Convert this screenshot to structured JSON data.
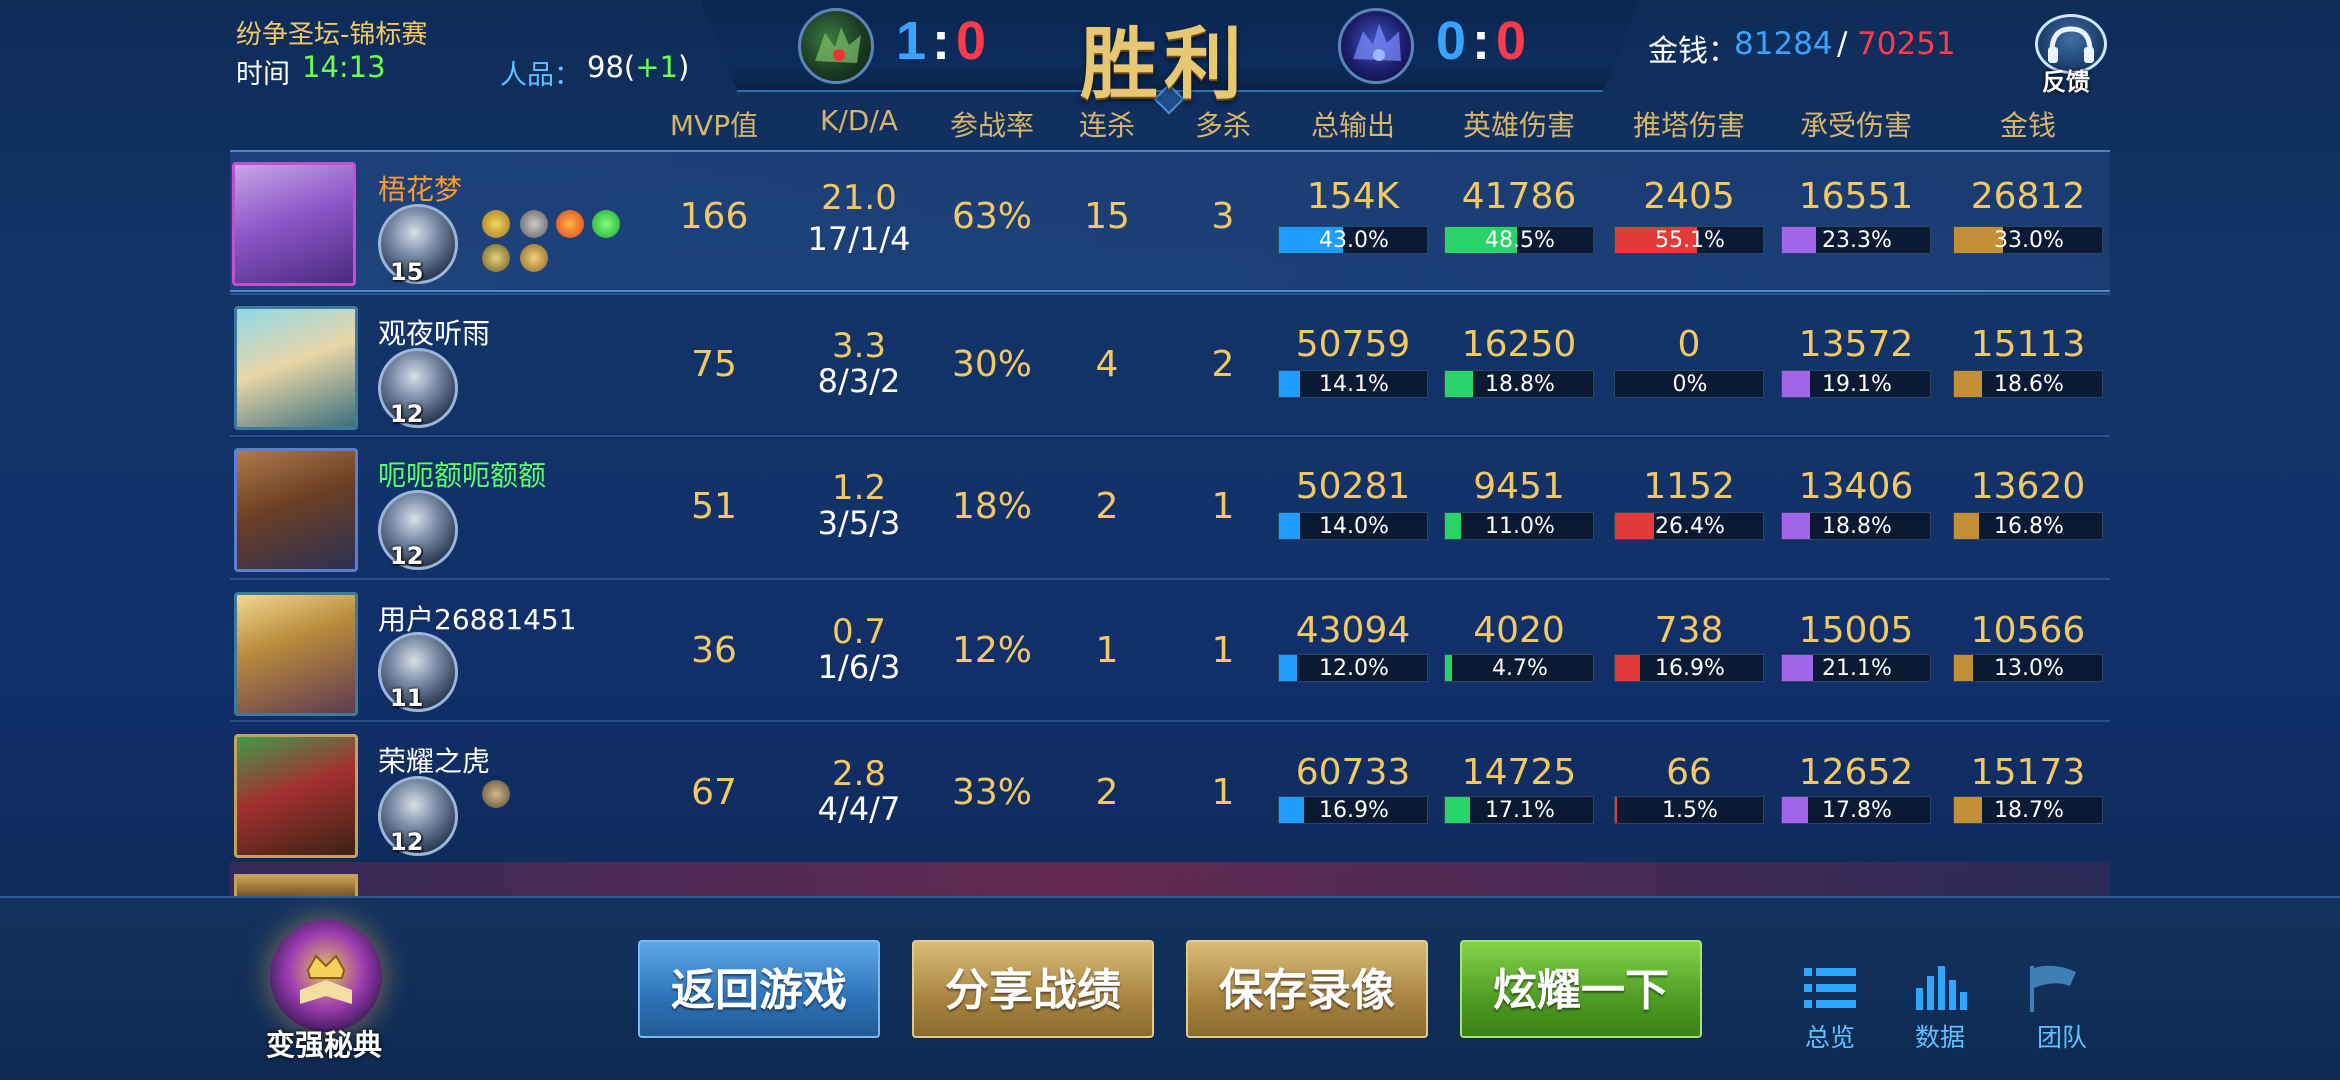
{
  "header": {
    "match_title": "纷争圣坛-锦标赛",
    "time_label": "时间",
    "time_value": "14:13",
    "rp_label": "人品：",
    "rp_value": "98(",
    "rp_plus": "+1",
    "rp_close": ")",
    "score_left": {
      "blue": "1",
      "colon": ":",
      "red": "0"
    },
    "result": "胜利",
    "score_right": {
      "blue": "0",
      "colon": ":",
      "red": "0"
    },
    "gold_label": "金钱：",
    "gold_blue": "81284",
    "gold_sep": "/",
    "gold_red": "70251",
    "feedback_label": "反馈",
    "feedback_icon": "headset-icon",
    "left_team_icon": "dragon-emblem-icon",
    "right_team_icon": "dark-dragon-emblem-icon"
  },
  "columns": {
    "mvp": "MVP值",
    "kda": "K/D/A",
    "participation": "参战率",
    "streak": "连杀",
    "multikill": "多杀",
    "total_output": "总输出",
    "hero_damage": "英雄伤害",
    "tower_damage": "推塔伤害",
    "damage_taken": "承受伤害",
    "gold": "金钱"
  },
  "players": [
    {
      "name": "梧花梦",
      "level": "15",
      "mvp": "166",
      "kda_ratio": "21.0",
      "kda": "17/1/4",
      "participation": "63%",
      "streak": "15",
      "multikill": "3",
      "output": "154K",
      "output_pct": "43.0%",
      "output_fill": 0.43,
      "hero": "41786",
      "hero_pct": "48.5%",
      "hero_fill": 0.485,
      "tower": "2405",
      "tower_pct": "55.1%",
      "tower_fill": 0.551,
      "taken": "16551",
      "taken_pct": "23.3%",
      "taken_fill": 0.233,
      "gold": "26812",
      "gold_pct": "33.0%",
      "gold_fill": 0.33
    },
    {
      "name": "观夜听雨",
      "level": "12",
      "mvp": "75",
      "kda_ratio": "3.3",
      "kda": "8/3/2",
      "participation": "30%",
      "streak": "4",
      "multikill": "2",
      "output": "50759",
      "output_pct": "14.1%",
      "output_fill": 0.141,
      "hero": "16250",
      "hero_pct": "18.8%",
      "hero_fill": 0.188,
      "tower": "0",
      "tower_pct": "0%",
      "tower_fill": 0,
      "taken": "13572",
      "taken_pct": "19.1%",
      "taken_fill": 0.191,
      "gold": "15113",
      "gold_pct": "18.6%",
      "gold_fill": 0.186
    },
    {
      "name": "呃呃额呃额额",
      "level": "12",
      "mvp": "51",
      "kda_ratio": "1.2",
      "kda": "3/5/3",
      "participation": "18%",
      "streak": "2",
      "multikill": "1",
      "output": "50281",
      "output_pct": "14.0%",
      "output_fill": 0.14,
      "hero": "9451",
      "hero_pct": "11.0%",
      "hero_fill": 0.11,
      "tower": "1152",
      "tower_pct": "26.4%",
      "tower_fill": 0.264,
      "taken": "13406",
      "taken_pct": "18.8%",
      "taken_fill": 0.188,
      "gold": "13620",
      "gold_pct": "16.8%",
      "gold_fill": 0.168
    },
    {
      "name": "用户26881451",
      "level": "11",
      "mvp": "36",
      "kda_ratio": "0.7",
      "kda": "1/6/3",
      "participation": "12%",
      "streak": "1",
      "multikill": "1",
      "output": "43094",
      "output_pct": "12.0%",
      "output_fill": 0.12,
      "hero": "4020",
      "hero_pct": "4.7%",
      "hero_fill": 0.047,
      "tower": "738",
      "tower_pct": "16.9%",
      "tower_fill": 0.169,
      "taken": "15005",
      "taken_pct": "21.1%",
      "taken_fill": 0.211,
      "gold": "10566",
      "gold_pct": "13.0%",
      "gold_fill": 0.13
    },
    {
      "name": "荣耀之虎",
      "level": "12",
      "mvp": "67",
      "kda_ratio": "2.8",
      "kda": "4/4/7",
      "participation": "33%",
      "streak": "2",
      "multikill": "1",
      "output": "60733",
      "output_pct": "16.9%",
      "output_fill": 0.169,
      "hero": "14725",
      "hero_pct": "17.1%",
      "hero_fill": 0.171,
      "tower": "66",
      "tower_pct": "1.5%",
      "tower_fill": 0.015,
      "taken": "12652",
      "taken_pct": "17.8%",
      "taken_fill": 0.178,
      "gold": "15173",
      "gold_pct": "18.7%",
      "gold_fill": 0.187
    }
  ],
  "colors": {
    "output": "#1e9cff",
    "hero": "#28d36a",
    "tower": "#e43a3a",
    "taken": "#a065e8",
    "gold": "#c28f36"
  },
  "bottom": {
    "guide_label": "变强秘典",
    "btn_return": "返回游戏",
    "btn_share": "分享战绩",
    "btn_save": "保存录像",
    "btn_show": "炫耀一下",
    "nav_overview": "总览",
    "nav_data": "数据",
    "nav_team": "团队"
  }
}
